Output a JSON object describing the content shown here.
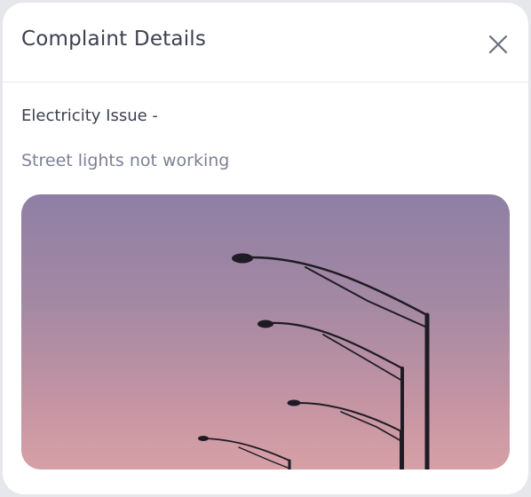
{
  "modal": {
    "title": "Complaint Details",
    "close_icon": "close-icon"
  },
  "complaint": {
    "category": "Electricity Issue -",
    "description": "Street lights not working",
    "photo_subject": "street-lights-photo"
  },
  "colors": {
    "text_primary": "#3d4150",
    "text_secondary": "#7d8193",
    "sky_top": "#8f7fa5",
    "sky_bottom": "#d7a0a6"
  }
}
